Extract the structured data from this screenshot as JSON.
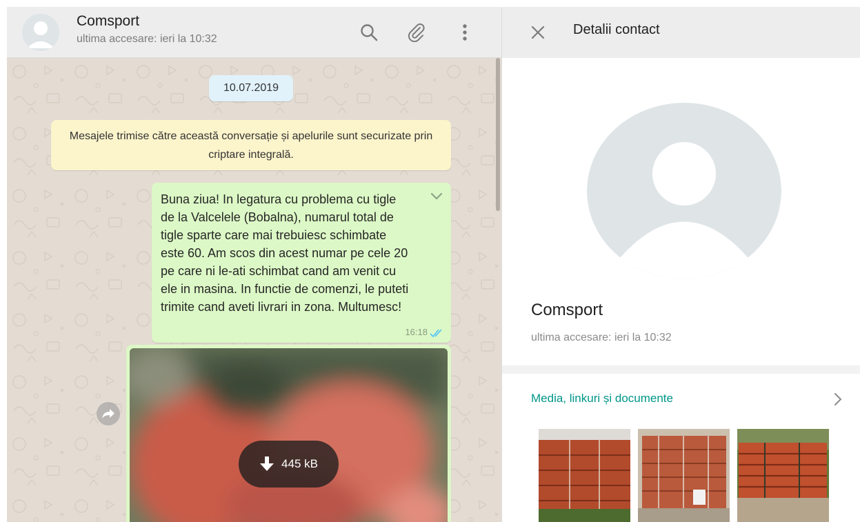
{
  "chat": {
    "contact_name": "Comsport",
    "last_seen": "ultima accesare: ieri la 10:32",
    "date_chip": "10.07.2019",
    "encryption_notice": "Mesajele trimise către această conversație și apelurile sunt securizate prin criptare integrală.",
    "message": {
      "text": "Buna ziua! In legatura cu problema cu tigle\nde la Valcelele (Bobalna), numarul total de\ntigle sparte care mai trebuiesc schimbate\neste 60. Am scos din acest numar pe cele 20\npe care ni le-ati schimbat cand am venit cu\nele in masina. In functie de comenzi, le puteti\ntrimite cand aveti livrari in zona. Multumesc!",
      "time": "16:18",
      "status_icon": "double-check-read-icon"
    },
    "image_message": {
      "download_size": "445 kB",
      "download_icon": "download-arrow-icon"
    },
    "icons": [
      "search-icon",
      "attach-icon",
      "menu-dots-icon",
      "forward-icon",
      "chevron-down-icon"
    ]
  },
  "contact_panel": {
    "header_title": "Detalii contact",
    "close_icon": "close-icon",
    "name": "Comsport",
    "last_seen": "ultima accesare: ieri la 10:32",
    "media_label": "Media, linkuri și documente",
    "media_chevron_icon": "chevron-right-icon",
    "thumbnail_count_visible": 3
  },
  "colors": {
    "accent": "#009688",
    "outgoing_bubble": "#dcf8c6",
    "notice": "#fcf4cb",
    "date_chip": "#e1f2fb",
    "read_ticks": "#4fc3f7",
    "header_bg": "#ededed"
  }
}
